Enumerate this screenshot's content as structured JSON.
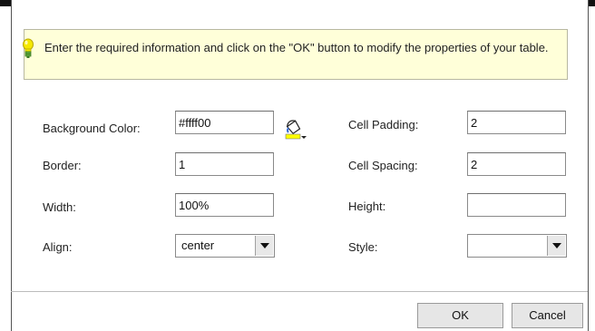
{
  "info": {
    "message": "Enter the required information and click on the \"OK\" button to modify the properties of your table."
  },
  "form": {
    "background_color": {
      "label": "Background Color:",
      "value": "#ffff00"
    },
    "border": {
      "label": "Border:",
      "value": "1"
    },
    "width": {
      "label": "Width:",
      "value": "100%"
    },
    "align": {
      "label": "Align:",
      "value": "center"
    },
    "cell_padding": {
      "label": "Cell Padding:",
      "value": "2"
    },
    "cell_spacing": {
      "label": "Cell Spacing:",
      "value": "2"
    },
    "height": {
      "label": "Height:",
      "value": ""
    },
    "style": {
      "label": "Style:",
      "value": ""
    }
  },
  "icons": {
    "info": "lightbulb-icon",
    "color_picker": "paint-bucket-icon"
  },
  "colors": {
    "info_background": "#ffffd9",
    "swatch": "#ffff00"
  },
  "buttons": {
    "ok": "OK",
    "cancel": "Cancel"
  }
}
